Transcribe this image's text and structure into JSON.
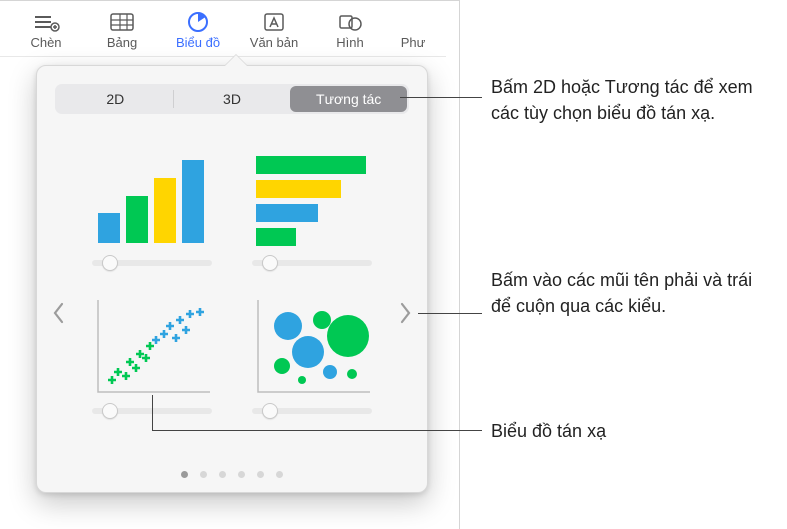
{
  "toolbar": {
    "items": [
      {
        "label": "Chèn"
      },
      {
        "label": "Bảng"
      },
      {
        "label": "Biểu đồ"
      },
      {
        "label": "Văn bản"
      },
      {
        "label": "Hình"
      },
      {
        "label": "Phư"
      }
    ]
  },
  "popover": {
    "tabs": {
      "tab_2d": "2D",
      "tab_3d": "3D",
      "tab_interactive": "Tương tác"
    },
    "page_dots": {
      "count": 6,
      "active": 0
    }
  },
  "callouts": {
    "c1": "Bấm 2D hoặc Tương tác để xem các tùy chọn biểu đồ tán xạ.",
    "c2": "Bấm vào các mũi tên phải và trái để cuộn qua các kiểu.",
    "c3": "Biểu đồ tán xạ"
  }
}
